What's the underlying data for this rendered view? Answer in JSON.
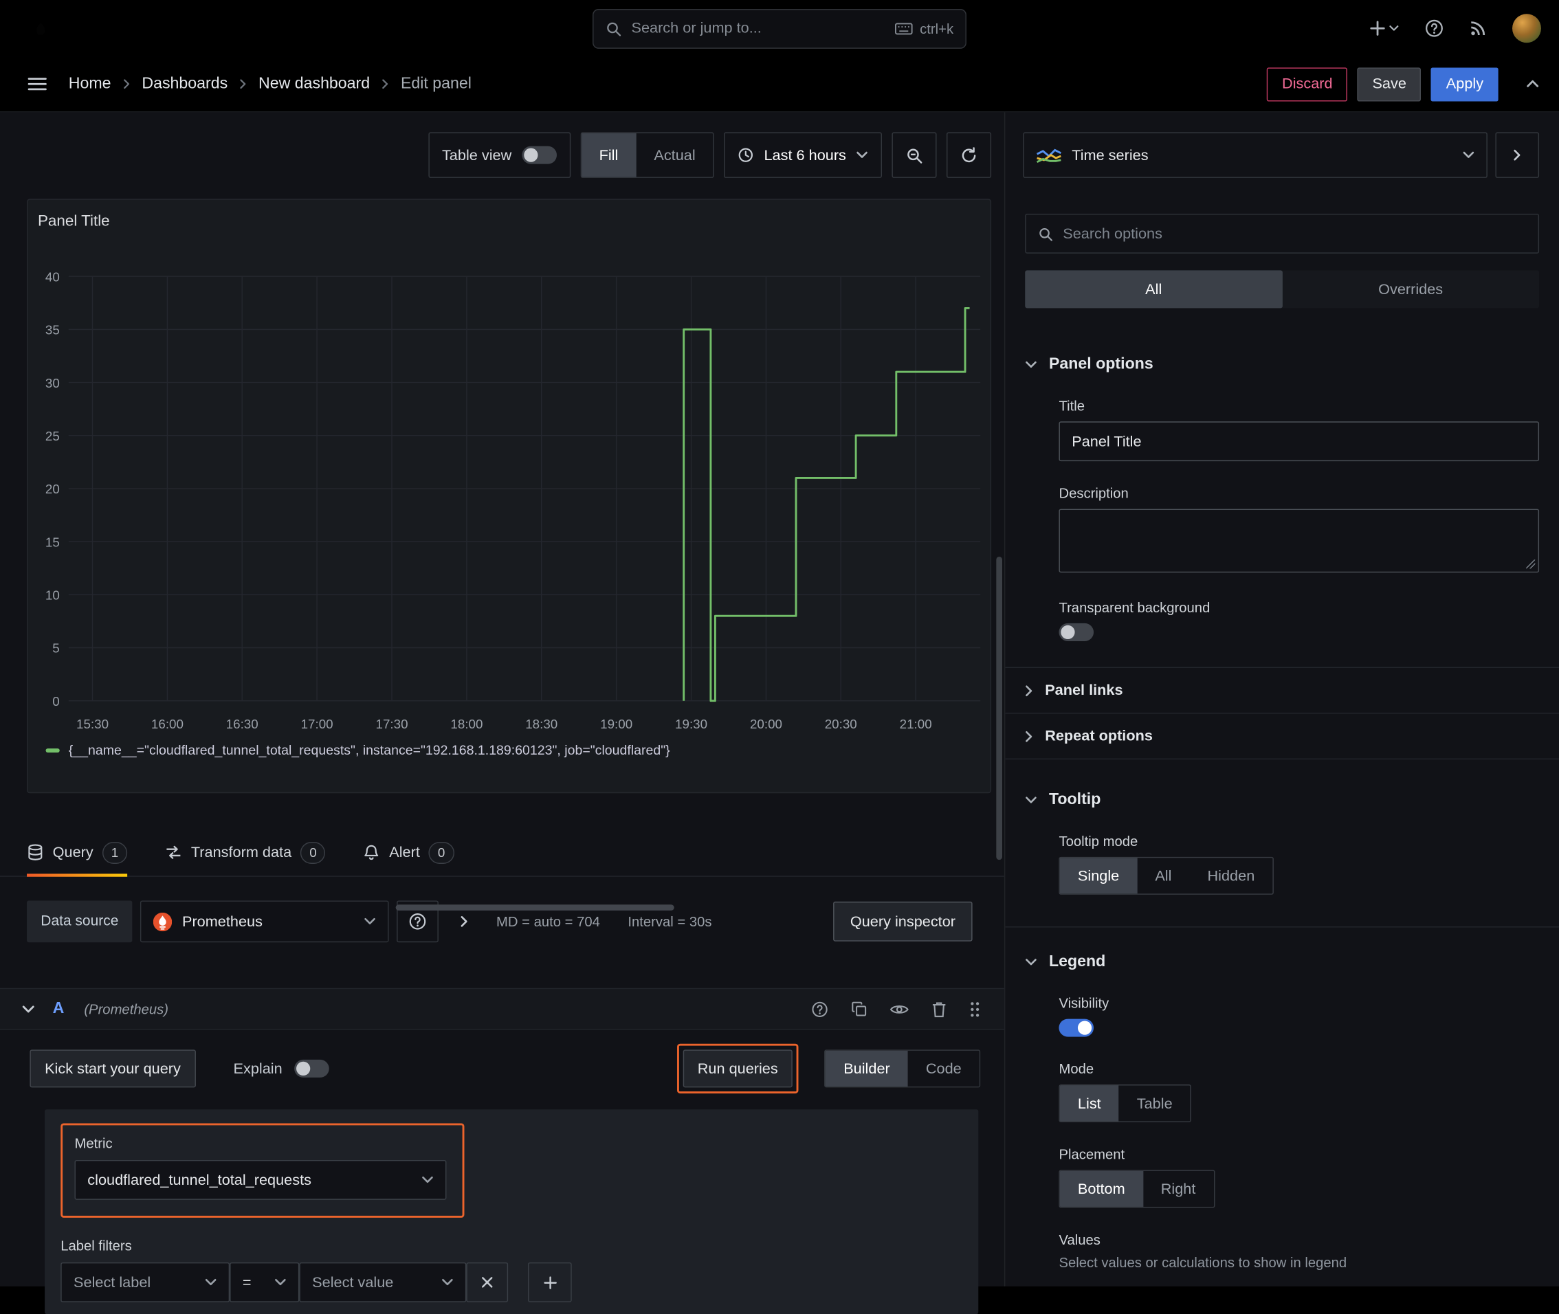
{
  "topnav": {
    "search_placeholder": "Search or jump to...",
    "search_shortcut": "ctrl+k"
  },
  "breadcrumb": {
    "items": [
      "Home",
      "Dashboards",
      "New dashboard",
      "Edit panel"
    ]
  },
  "actions": {
    "discard": "Discard",
    "save": "Save",
    "apply": "Apply"
  },
  "toolbar": {
    "table_view_label": "Table view",
    "fill_label": "Fill",
    "actual_label": "Actual",
    "time_range_label": "Last 6 hours"
  },
  "panel": {
    "title": "Panel Title",
    "legend_text": "{__name__=\"cloudflared_tunnel_total_requests\", instance=\"192.168.1.189:60123\", job=\"cloudflared\"}"
  },
  "chart_data": {
    "type": "line",
    "title": "Panel Title",
    "line_color": "#73bf69",
    "grid": true,
    "legend_position": "bottom",
    "x_ticks": [
      "15:30",
      "16:00",
      "16:30",
      "17:00",
      "17:30",
      "18:00",
      "18:30",
      "19:00",
      "19:30",
      "20:00",
      "20:30",
      "21:00"
    ],
    "x_tick_hours": [
      15.5,
      16,
      16.5,
      17,
      17.5,
      18,
      18.5,
      19,
      19.5,
      20,
      20.5,
      21
    ],
    "y_ticks": [
      0,
      5,
      10,
      15,
      20,
      25,
      30,
      35,
      40
    ],
    "ylim": [
      0,
      40
    ],
    "xlim_hours": [
      15.34,
      21.43
    ],
    "series": [
      {
        "name": "{__name__=\"cloudflared_tunnel_total_requests\", instance=\"192.168.1.189:60123\", job=\"cloudflared\"}",
        "step": true,
        "points": [
          [
            19.45,
            0
          ],
          [
            19.45,
            35
          ],
          [
            19.63,
            35
          ],
          [
            19.63,
            0
          ],
          [
            19.66,
            0
          ],
          [
            19.66,
            8
          ],
          [
            20.2,
            8
          ],
          [
            20.2,
            21
          ],
          [
            20.6,
            21
          ],
          [
            20.6,
            25
          ],
          [
            20.87,
            25
          ],
          [
            20.87,
            31
          ],
          [
            21.33,
            31
          ],
          [
            21.33,
            37
          ],
          [
            21.36,
            37
          ]
        ]
      }
    ]
  },
  "tabs": [
    {
      "label": "Query",
      "count": "1"
    },
    {
      "label": "Transform data",
      "count": "0"
    },
    {
      "label": "Alert",
      "count": "0"
    }
  ],
  "query": {
    "datasource_label": "Data source",
    "datasource_name": "Prometheus",
    "stats_md": "MD = auto = 704",
    "stats_interval": "Interval = 30s",
    "query_inspector_label": "Query inspector",
    "ref_id": "A",
    "ref_ds": "(Prometheus)",
    "kickstart_label": "Kick start your query",
    "explain_label": "Explain",
    "run_queries_label": "Run queries",
    "builder_label": "Builder",
    "code_label": "Code",
    "metric_label": "Metric",
    "metric_value": "cloudflared_tunnel_total_requests",
    "label_filters_label": "Label filters",
    "select_label_placeholder": "Select label",
    "operator": "=",
    "select_value_placeholder": "Select value"
  },
  "options": {
    "viz_name": "Time series",
    "search_placeholder": "Search options",
    "tab_all": "All",
    "tab_overrides": "Overrides",
    "panel_options_title": "Panel options",
    "title_label": "Title",
    "title_value": "Panel Title",
    "description_label": "Description",
    "transparent_label": "Transparent background",
    "panel_links_title": "Panel links",
    "repeat_options_title": "Repeat options",
    "tooltip_title": "Tooltip",
    "tooltip_mode_label": "Tooltip mode",
    "tooltip_modes": [
      "Single",
      "All",
      "Hidden"
    ],
    "legend_title": "Legend",
    "visibility_label": "Visibility",
    "mode_label": "Mode",
    "legend_modes": [
      "List",
      "Table"
    ],
    "placement_label": "Placement",
    "placements": [
      "Bottom",
      "Right"
    ],
    "values_label": "Values",
    "values_help": "Select values or calculations to show in legend"
  }
}
